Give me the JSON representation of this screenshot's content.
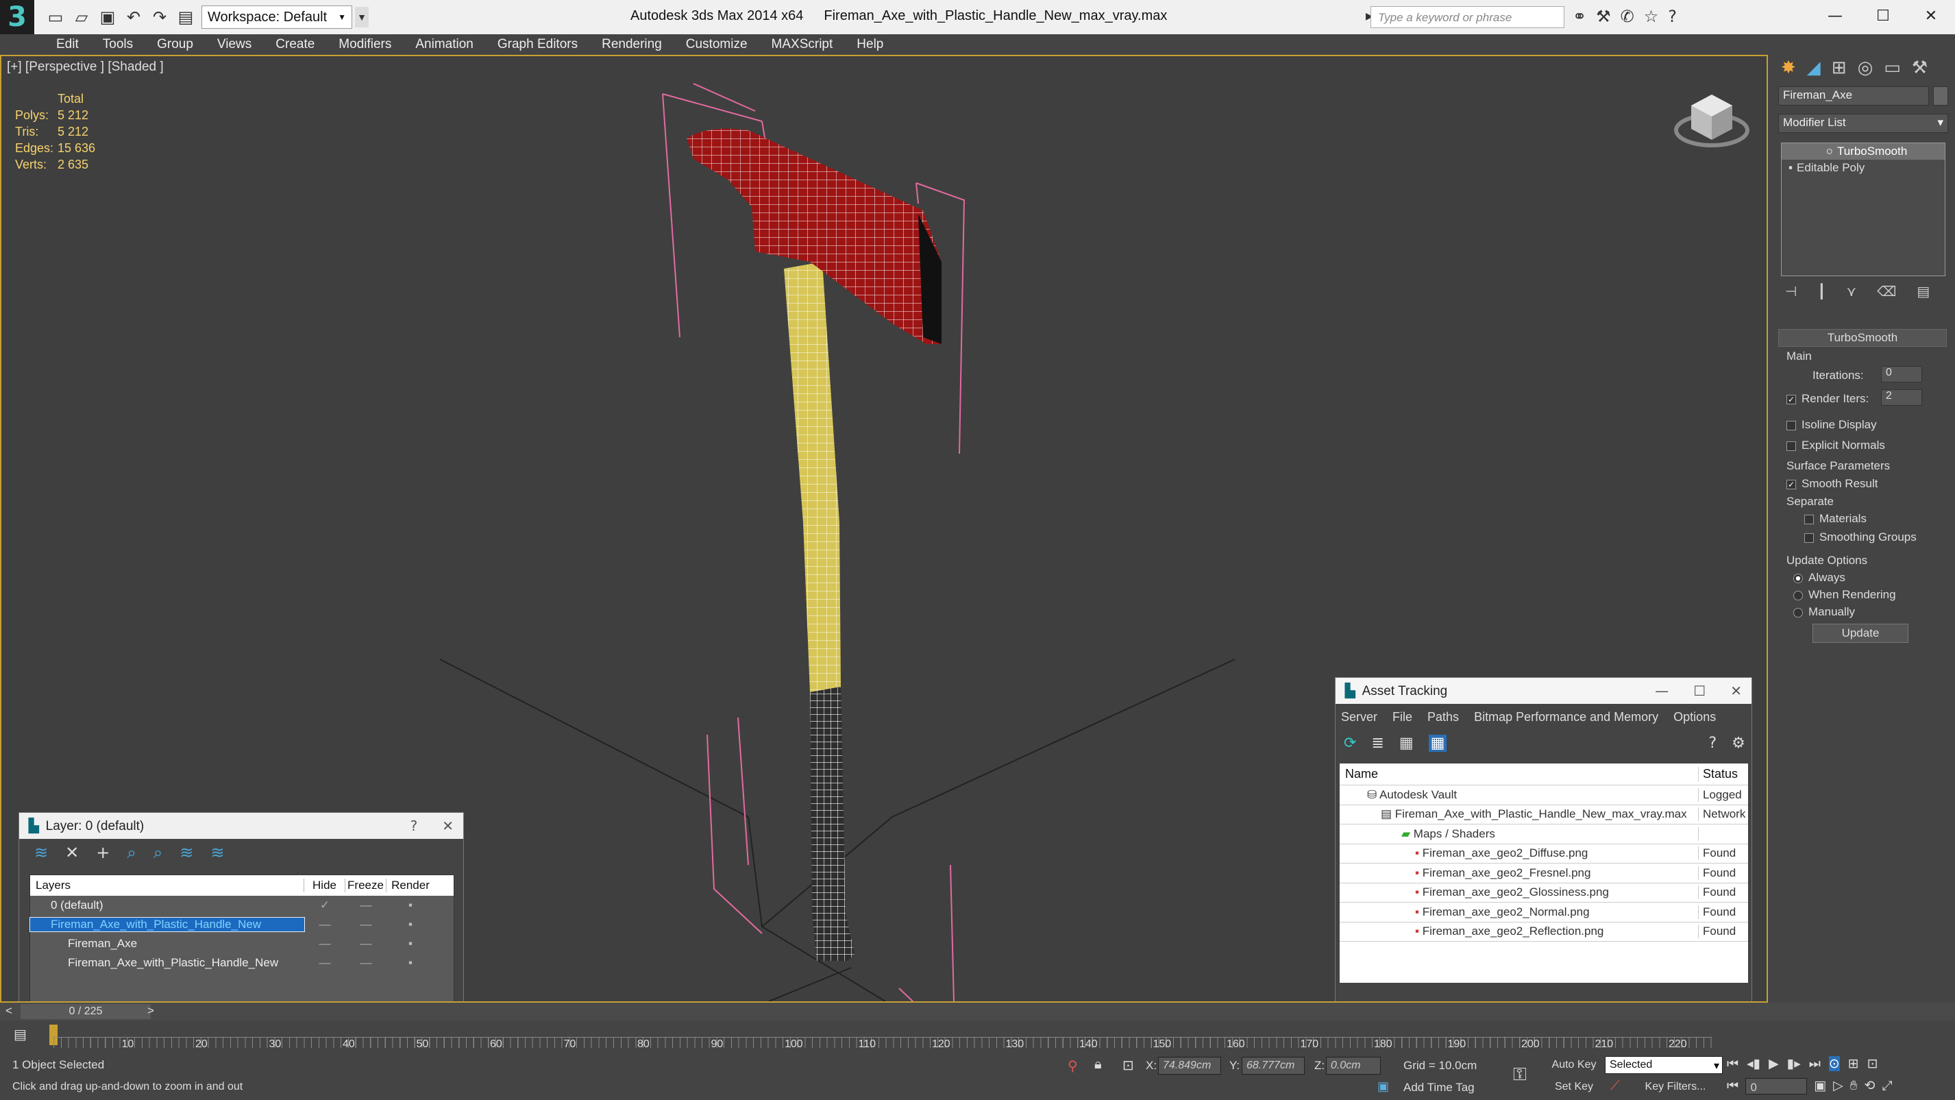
{
  "app": {
    "title": "Autodesk 3ds Max  2014 x64",
    "file": "Fireman_Axe_with_Plastic_Handle_New_max_vray.max",
    "workspace": "Workspace: Default",
    "search_placeholder": "Type a keyword or phrase"
  },
  "menu": [
    "Edit",
    "Tools",
    "Group",
    "Views",
    "Create",
    "Modifiers",
    "Animation",
    "Graph Editors",
    "Rendering",
    "Customize",
    "MAXScript",
    "Help"
  ],
  "viewport": {
    "label": "[+] [Perspective ] [Shaded ]",
    "stats": {
      "header": "Total",
      "rows": [
        {
          "k": "Polys:",
          "v": "5 212"
        },
        {
          "k": "Tris:",
          "v": "5 212"
        },
        {
          "k": "Edges:",
          "v": "15 636"
        },
        {
          "k": "Verts:",
          "v": "2 635"
        }
      ]
    }
  },
  "layer": {
    "title": "Layer: 0 (default)",
    "help": "?",
    "close": "✕",
    "cols": {
      "layers": "Layers",
      "hide": "Hide",
      "freeze": "Freeze",
      "render": "Render"
    },
    "rows": [
      "0 (default)",
      "Fireman_Axe_with_Plastic_Handle_New",
      "Fireman_Axe",
      "Fireman_Axe_with_Plastic_Handle_New"
    ]
  },
  "asset": {
    "title": "Asset Tracking",
    "menu": [
      "Server",
      "File",
      "Paths",
      "Bitmap Performance and Memory",
      "Options"
    ],
    "cols": {
      "name": "Name",
      "status": "Status"
    },
    "rows": [
      {
        "name": "Autodesk Vault",
        "status": "Logged"
      },
      {
        "name": "Fireman_Axe_with_Plastic_Handle_New_max_vray.max",
        "status": "Network"
      },
      {
        "name": "Maps / Shaders",
        "status": ""
      },
      {
        "name": "Fireman_axe_geo2_Diffuse.png",
        "status": "Found"
      },
      {
        "name": "Fireman_axe_geo2_Fresnel.png",
        "status": "Found"
      },
      {
        "name": "Fireman_axe_geo2_Glossiness.png",
        "status": "Found"
      },
      {
        "name": "Fireman_axe_geo2_Normal.png",
        "status": "Found"
      },
      {
        "name": "Fireman_axe_geo2_Reflection.png",
        "status": "Found"
      }
    ]
  },
  "cmd": {
    "object_name": "Fireman_Axe",
    "modifier_list": "Modifier List",
    "stack": [
      "TurboSmooth",
      "Editable Poly"
    ],
    "rollout": {
      "title": "TurboSmooth",
      "main": "Main",
      "iterations_label": "Iterations:",
      "iterations": "0",
      "render_iters_label": "Render Iters:",
      "render_iters": "2",
      "isoline": "Isoline Display",
      "explicit": "Explicit Normals",
      "surface": "Surface Parameters",
      "smooth": "Smooth Result",
      "separate": "Separate",
      "materials": "Materials",
      "smoothing": "Smoothing Groups",
      "update_opts": "Update Options",
      "always": "Always",
      "when_rendering": "When Rendering",
      "manually": "Manually",
      "update": "Update"
    }
  },
  "time": {
    "frame": "0 / 225",
    "ticks": [
      "10",
      "20",
      "30",
      "40",
      "50",
      "60",
      "70",
      "80",
      "90",
      "100",
      "110",
      "120",
      "130",
      "140",
      "150",
      "160",
      "170",
      "180",
      "190",
      "200",
      "210",
      "220"
    ]
  },
  "status": {
    "selected": "1 Object Selected",
    "prompt": "Click and drag up-and-down to zoom in and out",
    "x_label": "X:",
    "x": "74.849cm",
    "y_label": "Y:",
    "y": "68.777cm",
    "z_label": "Z:",
    "z": "0.0cm",
    "grid": "Grid = 10.0cm",
    "add_time_tag": "Add Time Tag",
    "auto_key": "Auto Key",
    "set_key": "Set Key",
    "selected_dd": "Selected",
    "key_filters": "Key Filters...",
    "frame_field": "0"
  }
}
